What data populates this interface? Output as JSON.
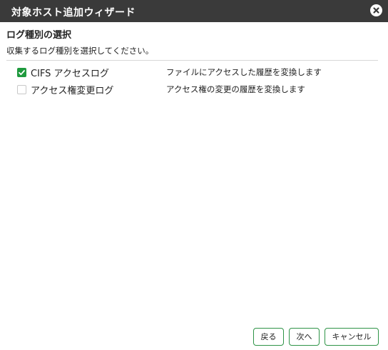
{
  "window": {
    "title": "対象ホスト追加ウィザード",
    "close_icon": "close-circle-icon"
  },
  "section": {
    "title": "ログ種別の選択",
    "instruction": "収集するログ種別を選択してください。"
  },
  "log_types": [
    {
      "name": "CIFS アクセスログ",
      "description": "ファイルにアクセスした履歴を変換します",
      "checked": true
    },
    {
      "name": "アクセス権変更ログ",
      "description": "アクセス権の変更の履歴を変換します",
      "checked": false
    }
  ],
  "buttons": {
    "back_label": "戻る",
    "next_label": "次へ",
    "cancel_label": "キャンセル"
  },
  "colors": {
    "titlebar": "#3a3a3a",
    "accent": "#1f9a3e"
  }
}
